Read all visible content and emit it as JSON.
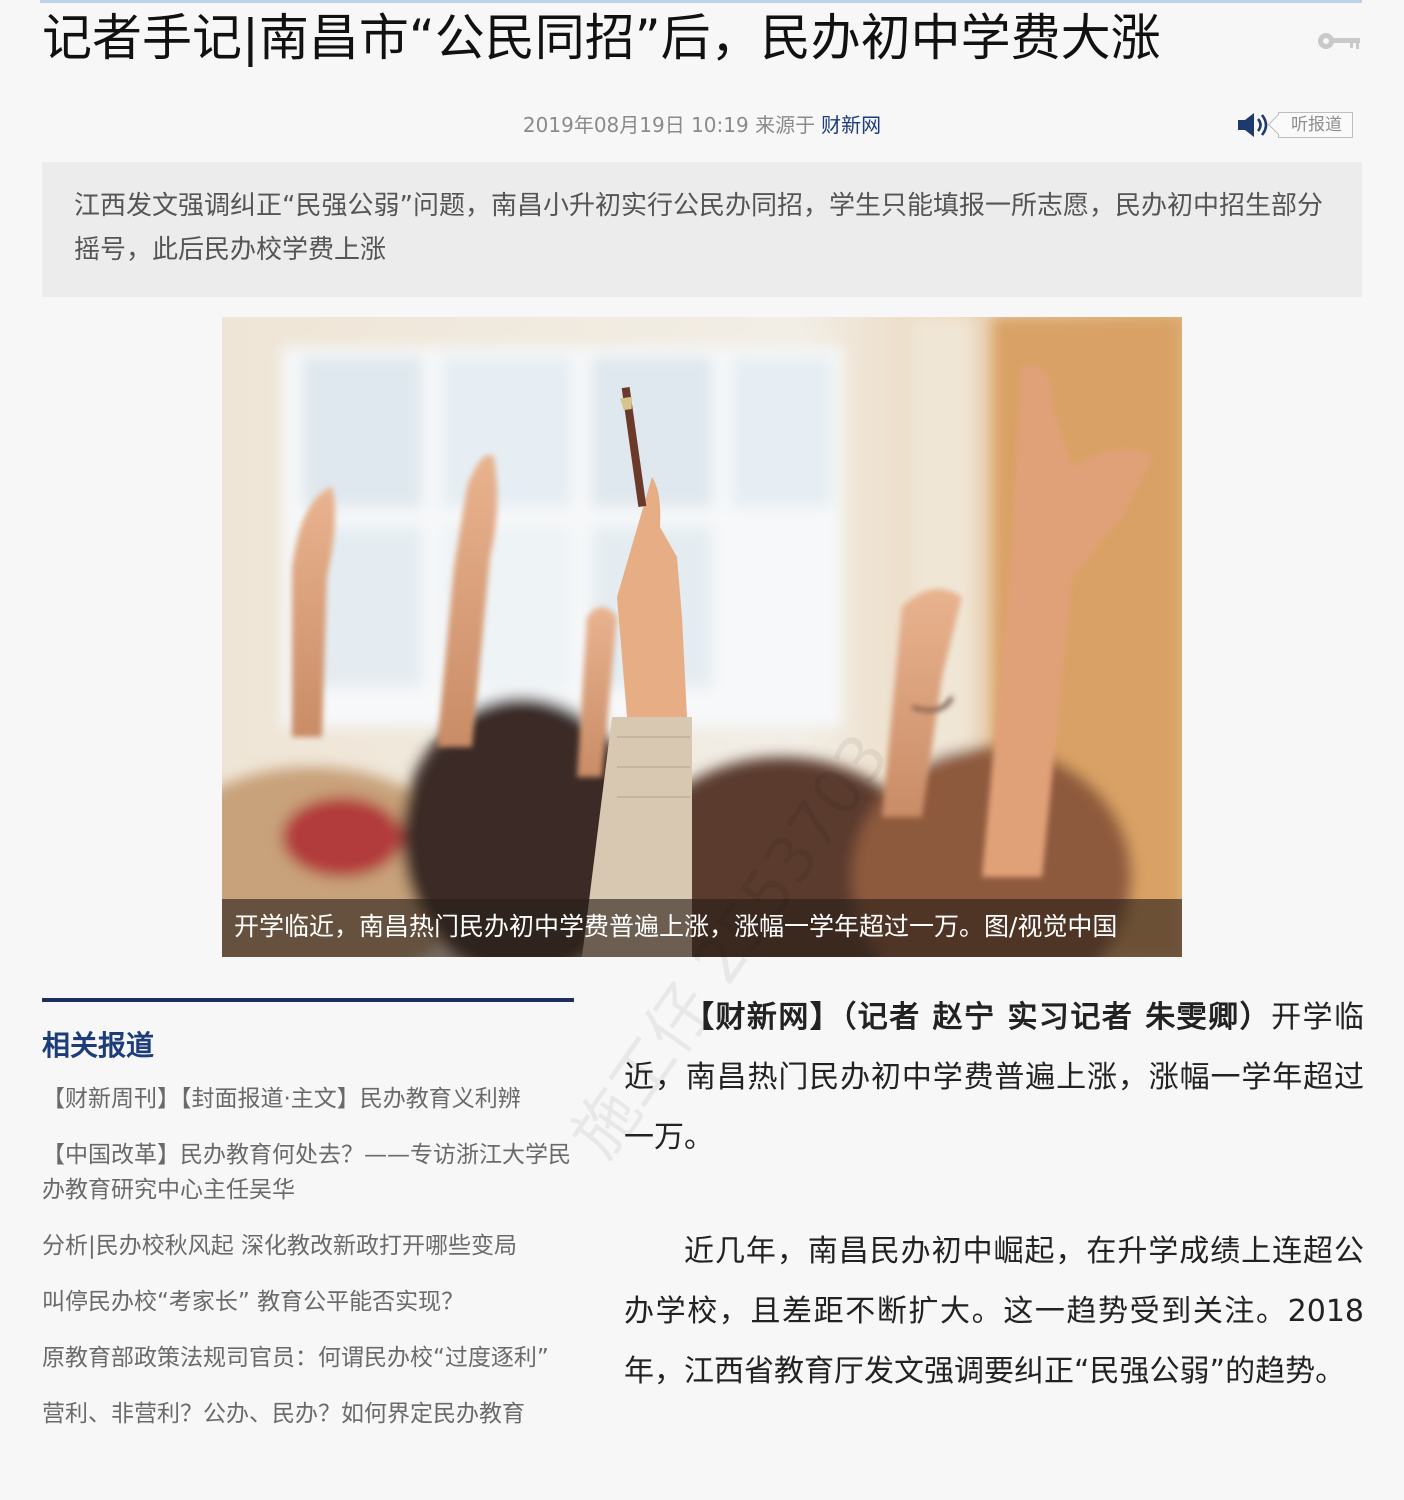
{
  "article": {
    "title": "记者手记|南昌市“公民同招”后，民办初中学费大涨",
    "date": "2019年08月19日 10:19 来源于",
    "source": "财新网",
    "listen_label": "听报道",
    "summary": "江西发文强调纠正“民强公弱”问题，南昌小升初实行公民办同招，学生只能填报一所志愿，民办初中招生部分摇号，此后民办校学费上涨",
    "photo_caption": "开学临近，南昌热门民办初中学费普遍上涨，涨幅一学年超过一万。图/视觉中国",
    "body": {
      "lead": "【财新网】（记者 赵宁 实习记者 朱雯卿）",
      "p1_rest": "开学临近，南昌热门民办初中学费普遍上涨，涨幅一学年超过一万。",
      "p2": "近几年，南昌民办初中崛起，在升学成绩上连超公办学校，且差距不断扩大。这一趋势受到关注。2018年，江西省教育厅发文强调要纠正“民强公弱”的趋势。"
    },
    "watermark": "施工仔 2553703"
  },
  "related": {
    "heading": "相关报道",
    "items": [
      {
        "label": "【财新周刊】【封面报道·主文】民办教育义利辨"
      },
      {
        "label": "【中国改革】民办教育何处去？——专访浙江大学民办教育研究中心主任吴华"
      },
      {
        "label": "分析|民办校秋风起 深化教改新政打开哪些变局"
      },
      {
        "label": "叫停民办校“考家长” 教育公平能否实现？"
      },
      {
        "label": "原教育部政策法规司官员：何谓民办校“过度逐利”"
      },
      {
        "label": "营利、非营利？公办、民办？如何界定民办教育"
      }
    ]
  },
  "icons": {
    "key": "key-icon",
    "speaker": "speaker-icon"
  },
  "colors": {
    "source_link": "#1c3d7a",
    "related_heading": "#1c3d7a",
    "related_rule": "#1d3060"
  }
}
